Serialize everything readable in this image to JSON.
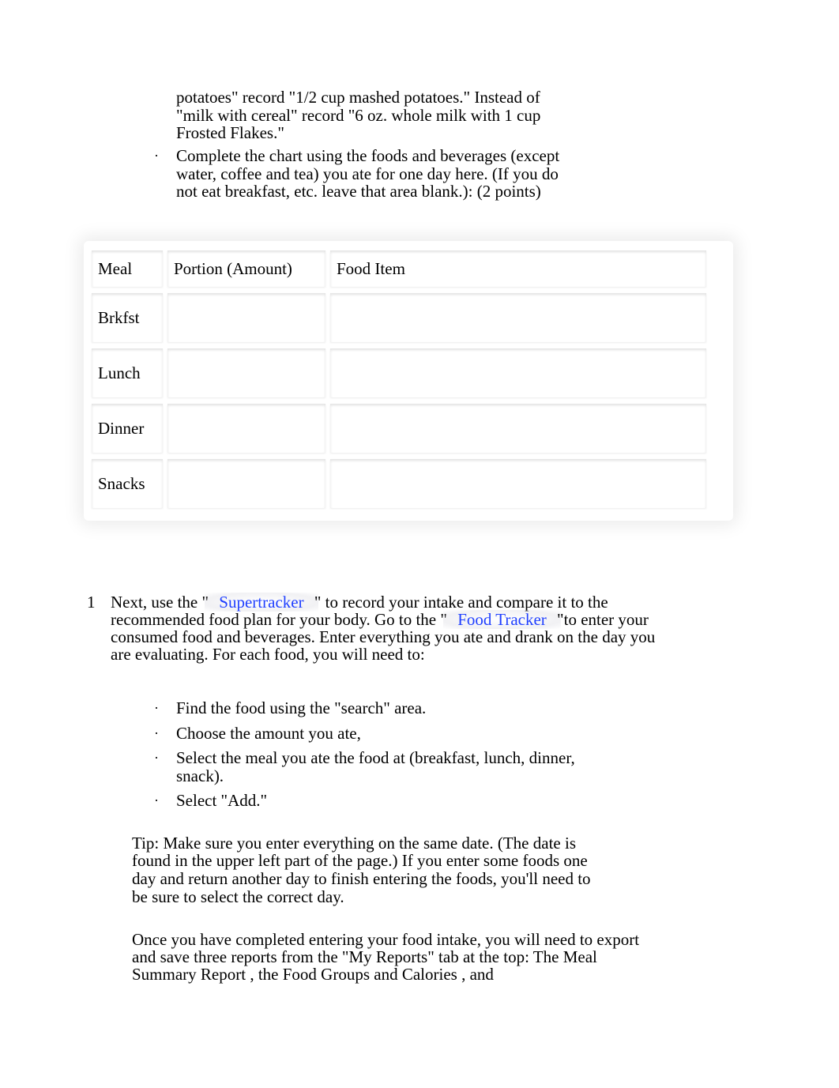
{
  "intro": {
    "prev_bullet_cont": "potatoes\" record \"1/2 cup mashed potatoes.\" Instead of \"milk with cereal\" record \"6 oz. whole milk with 1 cup Frosted Flakes.\"",
    "bullet_complete": "Complete the chart using the foods and beverages (except water, coffee and tea) you ate for one day here. (If you do not eat breakfast, etc. leave that area blank.): (2 points)"
  },
  "table": {
    "headers": {
      "meal": "Meal",
      "portion": "Portion (Amount)",
      "food": "Food Item"
    },
    "rows": {
      "brkfst": "Brkfst",
      "lunch": "Lunch",
      "dinner": "Dinner",
      "snacks": "Snacks"
    }
  },
  "step1": {
    "marker": "1",
    "pre_super": "Next, use the \"",
    "link_super": "Supertracker",
    "post_super": "\" to record your intake and compare it to the recommended food plan for your body. Go to the \"",
    "link_food": "Food Tracker",
    "post_food": "\"to enter your consumed food and beverages. Enter everything you ate and drank on the day you are evaluating. For each food, you will need to:"
  },
  "sub_steps": {
    "a": "Find the food using the \"search\" area.",
    "b": "Choose the amount you ate,",
    "c": "Select the meal you ate the food at (breakfast, lunch, dinner, snack).",
    "d": "Select \"Add.\""
  },
  "tip": "Tip: Make sure you enter everything on the same date. (The date is found in the upper left part of the page.) If you enter some foods one day and return another day to finish entering the foods, you'll need to be sure to select the correct day.",
  "once": {
    "p1": "Once you have completed entering your food intake, you will need to export and save three reports from the \"My Reports\" tab at the top: The ",
    "r1": "Meal Summary Report",
    "mid1": ", the ",
    "r2": "Food Groups",
    "mid2": " and ",
    "r3": "Calories",
    "end": ", and"
  },
  "bullet_char": "·"
}
